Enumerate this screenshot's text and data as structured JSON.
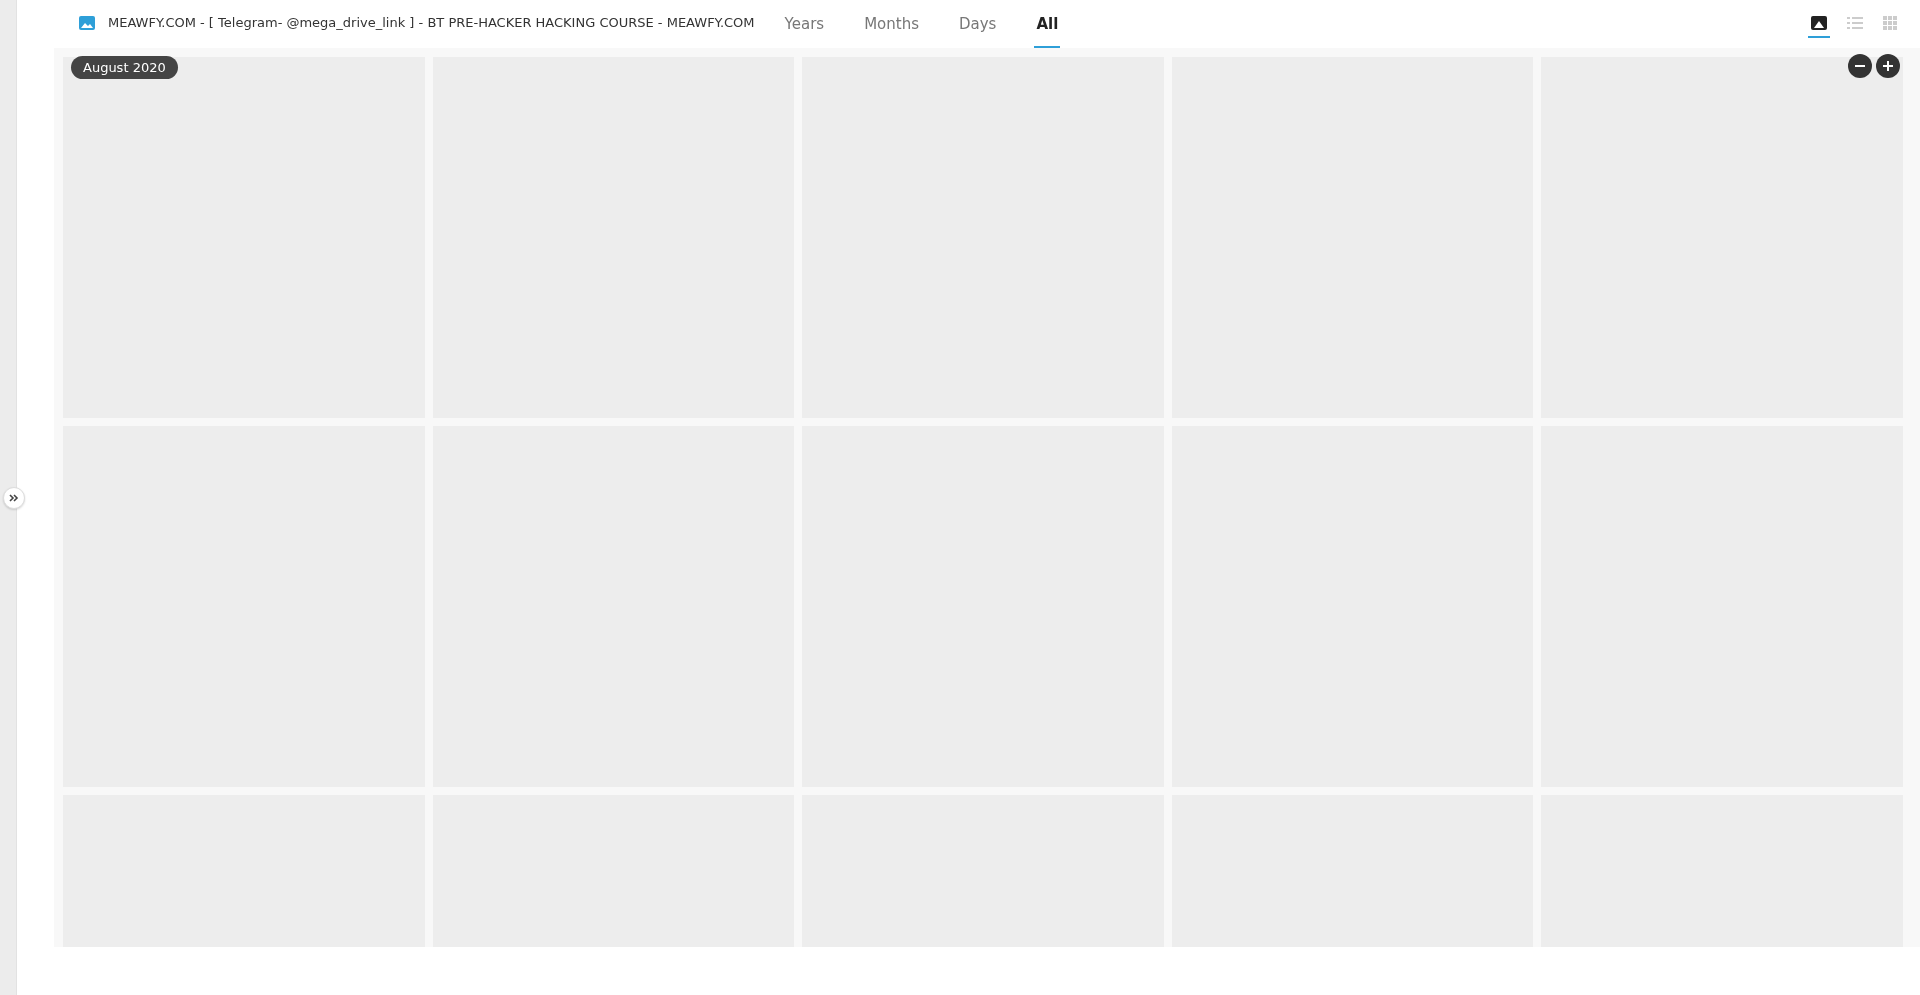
{
  "header": {
    "title": "MEAWFY.COM - [ Telegram- @mega_drive_link ] - BT PRE-HACKER HACKING COURSE - MEAWFY.COM"
  },
  "tabs": [
    {
      "label": "Years",
      "selected": false
    },
    {
      "label": "Months",
      "selected": false
    },
    {
      "label": "Days",
      "selected": false
    },
    {
      "label": "All",
      "selected": true
    }
  ],
  "view_modes": [
    {
      "kind": "image",
      "selected": true
    },
    {
      "kind": "list",
      "selected": false
    },
    {
      "kind": "grid",
      "selected": false
    }
  ],
  "date_badge": "August 2020",
  "tiles": [
    {
      "kind": "placeholder"
    },
    {
      "kind": "placeholder"
    },
    {
      "kind": "placeholder"
    },
    {
      "kind": "placeholder"
    },
    {
      "kind": "placeholder"
    },
    {
      "kind": "placeholder"
    },
    {
      "kind": "placeholder"
    },
    {
      "kind": "placeholder"
    },
    {
      "kind": "placeholder"
    },
    {
      "kind": "placeholder"
    },
    {
      "kind": "placeholder"
    },
    {
      "kind": "placeholder"
    },
    {
      "kind": "placeholder"
    },
    {
      "kind": "placeholder"
    },
    {
      "kind": "placeholder"
    }
  ]
}
